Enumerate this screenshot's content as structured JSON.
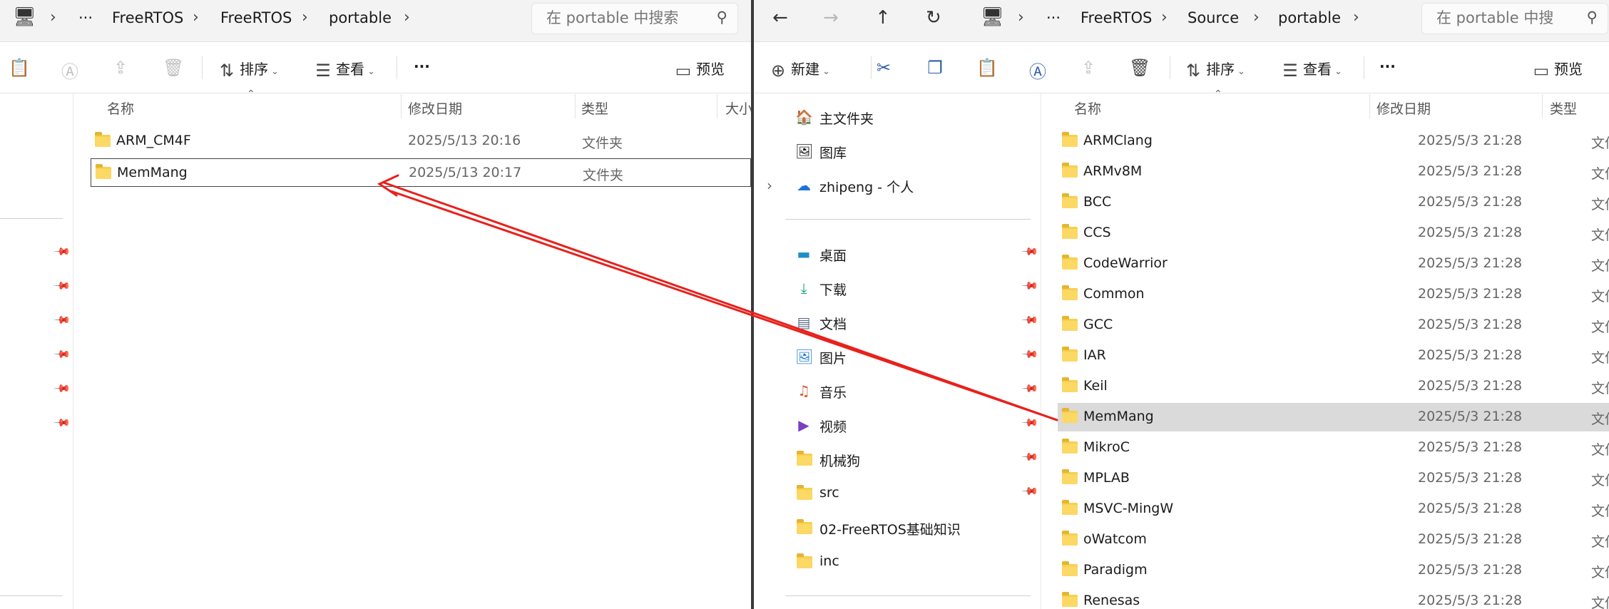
{
  "left": {
    "breadcrumb": [
      "FreeRTOS",
      "FreeRTOS",
      "portable"
    ],
    "ellipsis": "···",
    "search_placeholder": "在 portable 中搜索",
    "toolbar": {
      "sort": "排序",
      "view": "查看",
      "more": "···",
      "preview": "预览"
    },
    "columns": {
      "name": "名称",
      "modified": "修改日期",
      "type": "类型",
      "size": "大小"
    },
    "files": [
      {
        "name": "ARM_CM4F",
        "modified": "2025/5/13 20:16",
        "type": "文件夹"
      },
      {
        "name": "MemMang",
        "modified": "2025/5/13 20:17",
        "type": "文件夹"
      }
    ]
  },
  "right": {
    "breadcrumb": [
      "FreeRTOS",
      "Source",
      "portable"
    ],
    "ellipsis": "···",
    "search_placeholder": "在 portable 中搜",
    "toolbar": {
      "new": "新建",
      "sort": "排序",
      "view": "查看",
      "more": "···",
      "preview": "预览"
    },
    "nav": {
      "home": "主文件夹",
      "gallery": "图库",
      "onedrive": "zhipeng - 个人",
      "quick": [
        {
          "label": "桌面",
          "icon": "desktop-icon"
        },
        {
          "label": "下载",
          "icon": "download-icon"
        },
        {
          "label": "文档",
          "icon": "document-icon"
        },
        {
          "label": "图片",
          "icon": "pictures-icon"
        },
        {
          "label": "音乐",
          "icon": "music-icon"
        },
        {
          "label": "视频",
          "icon": "video-icon"
        },
        {
          "label": "机械狗",
          "icon": "folder-icon"
        },
        {
          "label": "src",
          "icon": "folder-icon"
        },
        {
          "label": "02-FreeRTOS基础知识",
          "icon": "folder-icon"
        },
        {
          "label": "inc",
          "icon": "folder-icon"
        }
      ]
    },
    "columns": {
      "name": "名称",
      "modified": "修改日期",
      "type": "类型"
    },
    "files": [
      {
        "name": "ARMClang",
        "modified": "2025/5/3 21:28",
        "type": "文件夹"
      },
      {
        "name": "ARMv8M",
        "modified": "2025/5/3 21:28",
        "type": "文件夹"
      },
      {
        "name": "BCC",
        "modified": "2025/5/3 21:28",
        "type": "文件夹"
      },
      {
        "name": "CCS",
        "modified": "2025/5/3 21:28",
        "type": "文件夹"
      },
      {
        "name": "CodeWarrior",
        "modified": "2025/5/3 21:28",
        "type": "文件夹"
      },
      {
        "name": "Common",
        "modified": "2025/5/3 21:28",
        "type": "文件夹"
      },
      {
        "name": "GCC",
        "modified": "2025/5/3 21:28",
        "type": "文件夹"
      },
      {
        "name": "IAR",
        "modified": "2025/5/3 21:28",
        "type": "文件夹"
      },
      {
        "name": "Keil",
        "modified": "2025/5/3 21:28",
        "type": "文件夹"
      },
      {
        "name": "MemMang",
        "modified": "2025/5/3 21:28",
        "type": "文件夹"
      },
      {
        "name": "MikroC",
        "modified": "2025/5/3 21:28",
        "type": "文件夹"
      },
      {
        "name": "MPLAB",
        "modified": "2025/5/3 21:28",
        "type": "文件夹"
      },
      {
        "name": "MSVC-MingW",
        "modified": "2025/5/3 21:28",
        "type": "文件夹"
      },
      {
        "name": "oWatcom",
        "modified": "2025/5/3 21:28",
        "type": "文件夹"
      },
      {
        "name": "Paradigm",
        "modified": "2025/5/3 21:28",
        "type": "文件夹"
      },
      {
        "name": "Renesas",
        "modified": "2025/5/3 21:28",
        "type": "文件夹"
      }
    ]
  },
  "annotation_color": "#e8211c"
}
